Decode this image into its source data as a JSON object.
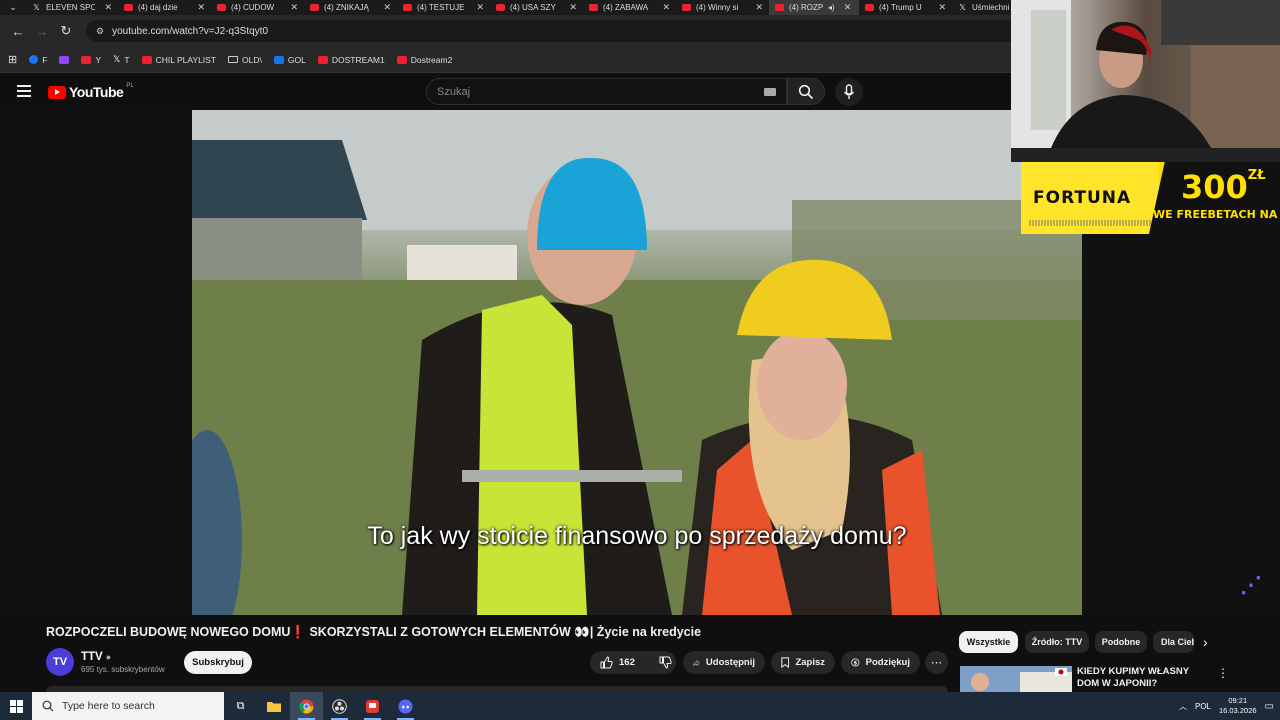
{
  "browser": {
    "tabs": [
      {
        "title": "ELEVEN SPO",
        "icon": "x-logo-icon"
      },
      {
        "title": "(4) daj dzie",
        "icon": "youtube-icon"
      },
      {
        "title": "(4) CUDOW",
        "icon": "youtube-icon"
      },
      {
        "title": "(4) ZNIKAJĄ",
        "icon": "youtube-icon"
      },
      {
        "title": "(4) TESTUJE",
        "icon": "youtube-icon"
      },
      {
        "title": "(4) USA SZY",
        "icon": "youtube-icon"
      },
      {
        "title": "(4) ZABAWA",
        "icon": "youtube-icon"
      },
      {
        "title": "(4) Winny si",
        "icon": "youtube-icon"
      },
      {
        "title": "(4) ROZP",
        "icon": "youtube-icon",
        "active": true
      },
      {
        "title": "(4) Trump U",
        "icon": "youtube-icon"
      },
      {
        "title": "Uśmiechni",
        "icon": "x-logo-icon"
      }
    ],
    "url": "youtube.com/watch?v=J2-q3Stqyt0",
    "bookmarks": [
      {
        "label": "F",
        "icon": "facebook-icon"
      },
      {
        "label": "",
        "icon": "twitch-icon"
      },
      {
        "label": "Y",
        "icon": "youtube-icon"
      },
      {
        "label": "T",
        "icon": "x-logo-icon"
      },
      {
        "label": "CHIL PLAYLIST",
        "icon": "youtube-icon"
      },
      {
        "label": "OLD\\",
        "icon": "folder-icon"
      },
      {
        "label": "GOL",
        "icon": "gol-icon"
      },
      {
        "label": "DOSTREAM1",
        "icon": "youtube-icon"
      },
      {
        "label": "Dostream2",
        "icon": "youtube-icon"
      }
    ]
  },
  "youtube": {
    "logo": "YouTube",
    "region": "PL",
    "search_placeholder": "Szukaj",
    "subtitle": "To jak wy stoicie finansowo po sprzedaży domu?",
    "video_title": "ROZPOCZELI BUDOWĘ NOWEGO DOMU❗ SKORZYSTALI Z GOTOWYCH ELEMENTÓW 👀| Życie na kredycie",
    "channel": {
      "name": "TTV",
      "subscribers": "695 tys. subskrybentów",
      "avatar_text": "TV"
    },
    "subscribe_label": "Subskrybuj",
    "likes": "162",
    "share_label": "Udostępnij",
    "save_label": "Zapisz",
    "thanks_label": "Podziękuj",
    "chips": [
      "Wszystkie",
      "Źródło: TTV",
      "Podobne",
      "Dla Ciebie"
    ],
    "recommended": {
      "title": "KIEDY KUPIMY WŁASNY DOM W JAPONII?"
    }
  },
  "overlay_ad": {
    "brand": "FORTUNA",
    "amount": "300",
    "currency": "ZŁ",
    "tagline": "WE FREEBETACH NA START"
  },
  "taskbar": {
    "search_placeholder": "Type here to search",
    "language": "POL",
    "time": "09:21",
    "date": "16.03.2026"
  },
  "colors": {
    "accent_red": "#ff0000",
    "ad_yellow": "#ffdc00",
    "taskbar": "#1c2a3a"
  }
}
